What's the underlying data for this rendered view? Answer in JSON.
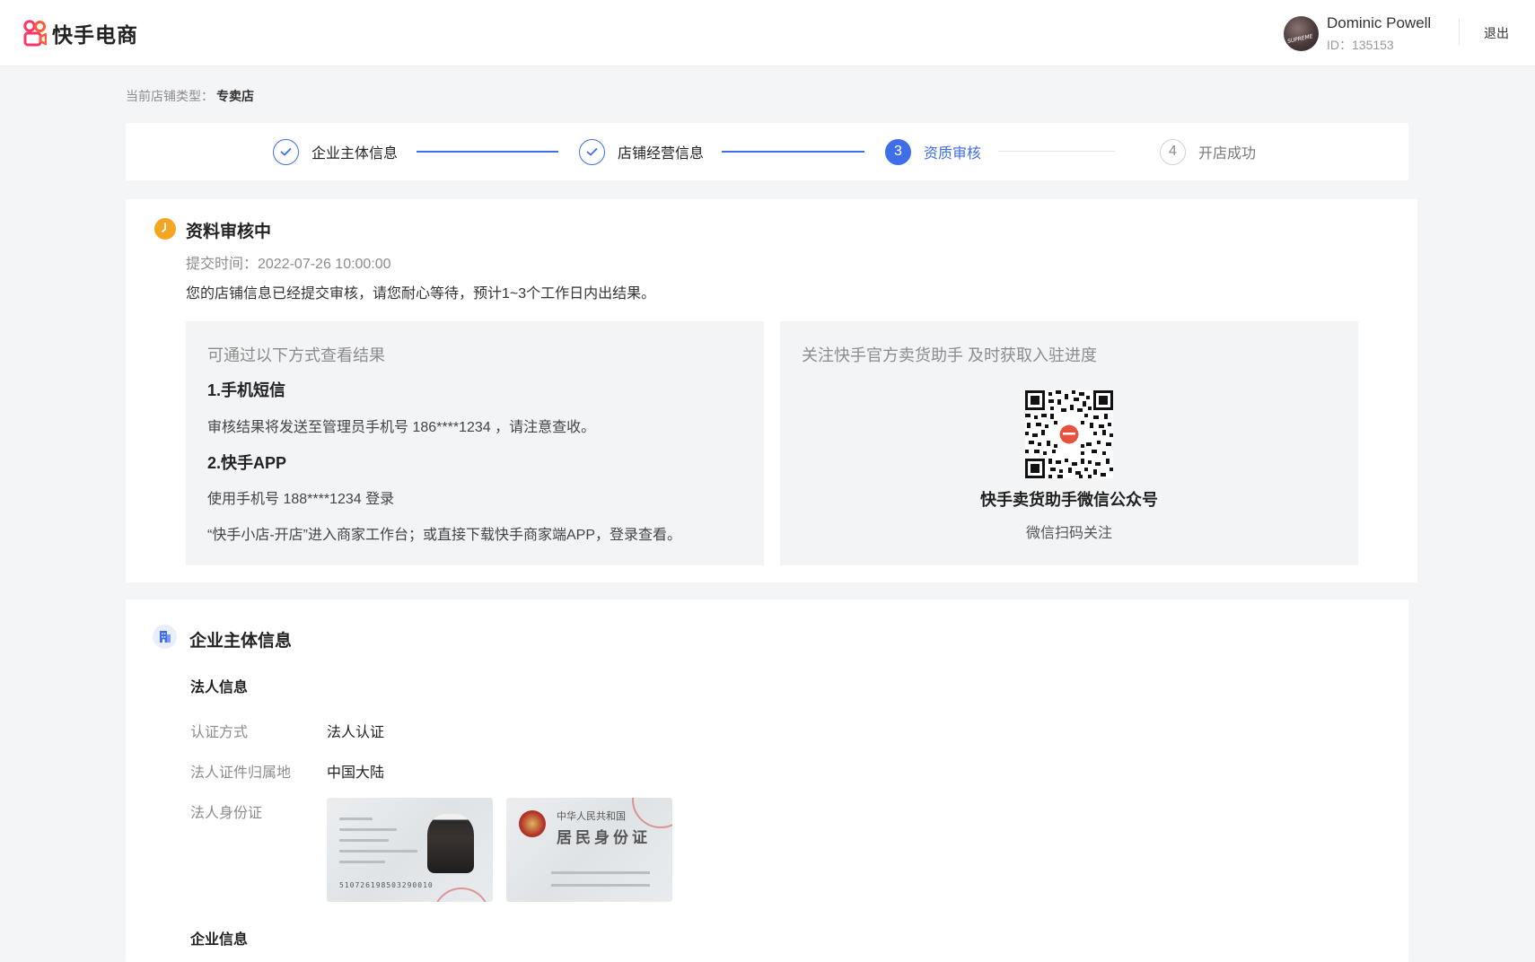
{
  "header": {
    "logo_text": "快手电商",
    "user_name": "Dominic Powell",
    "user_id": "ID：135153",
    "avatar_text": "SUPREME",
    "logout_label": "退出"
  },
  "shop_type": {
    "label": "当前店铺类型：",
    "value": "专卖店"
  },
  "steps": [
    {
      "label": "企业主体信息",
      "state": "done",
      "icon": "check-icon"
    },
    {
      "label": "店铺经营信息",
      "state": "done",
      "icon": "check-icon"
    },
    {
      "label": "资质审核",
      "state": "active",
      "number": "3"
    },
    {
      "label": "开店成功",
      "state": "pending",
      "number": "4"
    }
  ],
  "review": {
    "status_icon": "clock-icon",
    "title": "资料审核中",
    "submit_time": "提交时间：2022-07-26 10:00:00",
    "notice": "您的店铺信息已经提交审核，请您耐心等待，预计1~3个工作日内出结果。",
    "left_panel": {
      "subtitle": "可通过以下方式查看结果",
      "method1_title": "1.手机短信",
      "method1_text": "审核结果将发送至管理员手机号 186****1234 ，请注意查收。",
      "method2_title": "2.快手APP",
      "method2_text1": "使用手机号 188****1234 登录",
      "method2_text2": "“快手小店-开店”进入商家工作台；或直接下载快手商家端APP，登录查看。"
    },
    "right_panel": {
      "subtitle": "关注快手官方卖货助手 及时获取入驻进度",
      "qr_icon": "qr-code-icon",
      "qr_title": "快手卖货助手微信公众号",
      "qr_sub": "微信扫码关注"
    }
  },
  "enterprise": {
    "icon": "building-icon",
    "title": "企业主体信息",
    "legal_section": "法人信息",
    "rows": [
      {
        "label": "认证方式",
        "value": "法人认证"
      },
      {
        "label": "法人证件归属地",
        "value": "中国大陆"
      },
      {
        "label": "法人身份证",
        "value": ""
      }
    ],
    "id_front": {
      "number": "510726198503290010"
    },
    "id_back": {
      "title": "中华人民共和国",
      "big": "居民身份证"
    },
    "company_section": "企业信息"
  },
  "colors": {
    "accent": "#3f6ee8",
    "warning": "#f4a623",
    "brand": "#fe3666"
  }
}
